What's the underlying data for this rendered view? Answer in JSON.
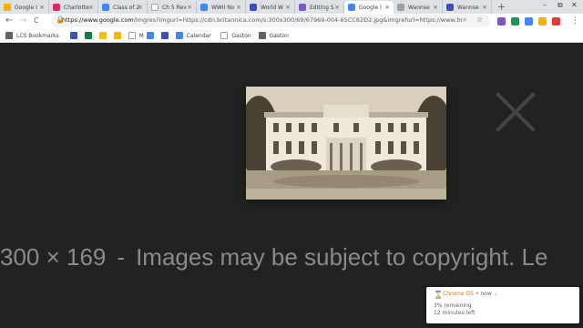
{
  "tabs": [
    {
      "title": "Google I",
      "favicon_color": "#f4b400",
      "active": false
    },
    {
      "title": "Charlotte",
      "favicon_color": "#e91e63",
      "active": false
    },
    {
      "title": "Class of 2",
      "favicon_color": "#4285f4",
      "active": false
    },
    {
      "title": "Ch 5 Rev",
      "favicon_color": "#ffffff",
      "active": false
    },
    {
      "title": "WWII No",
      "favicon_color": "#4285f4",
      "active": false
    },
    {
      "title": "World W",
      "favicon_color": "#3f51b5",
      "active": false
    },
    {
      "title": "Editing S",
      "favicon_color": "#7e57c2",
      "active": false
    },
    {
      "title": "Google I",
      "favicon_color": "#4285f4",
      "active": true
    },
    {
      "title": "Wannse",
      "favicon_color": "#9e9e9e",
      "active": false
    },
    {
      "title": "Wannse",
      "favicon_color": "#3f51b5",
      "active": false
    }
  ],
  "tab_close_glyph": "×",
  "new_tab_glyph": "+",
  "window_controls": {
    "minimize": "–",
    "maximize": "⧉",
    "close": "✕"
  },
  "toolbar": {
    "back_glyph": "←",
    "forward_glyph": "→",
    "reload_glyph": "C",
    "url_host": "https://www.google.com",
    "url_rest": "/imgres?imgurl=https://cdn.britannica.com/s:300x300/69/67969-004-65CC62D2.jpg&imgrefurl=https://www.britannica.c...",
    "menu_glyph": "⋮"
  },
  "extension_colors": [
    "#7e57c2",
    "#0f9d58",
    "#4285f4",
    "#f4b400",
    "#e53935"
  ],
  "bookmarks": [
    {
      "label": "LCS Bookmarks",
      "icon_color": "#5f6368"
    },
    {
      "label": "",
      "icon_color": "#3f51b5"
    },
    {
      "label": "",
      "icon_color": "#0b8043"
    },
    {
      "label": "",
      "icon_color": "#fbbc04"
    },
    {
      "label": "",
      "icon_color": "#f4b400"
    },
    {
      "label": "M",
      "icon_color": "#ffffff"
    },
    {
      "label": "",
      "icon_color": "#4285f4"
    },
    {
      "label": "",
      "icon_color": "#3f51b5"
    },
    {
      "label": "Calendar",
      "icon_color": "#4285f4"
    },
    {
      "label": "Gaston",
      "icon_color": "#ffffff"
    },
    {
      "label": "Gaston",
      "icon_color": "#5f6368"
    }
  ],
  "viewer": {
    "dimensions": "300 × 169",
    "separator": "-",
    "copyright": "Images may be subject to copyright.",
    "overflow": "Le"
  },
  "notification": {
    "icon": "⌛",
    "source": "Chrome OS",
    "time": "• now",
    "chevron": "⌄",
    "line1": "3% remaining",
    "line2": "12 minutes left"
  }
}
